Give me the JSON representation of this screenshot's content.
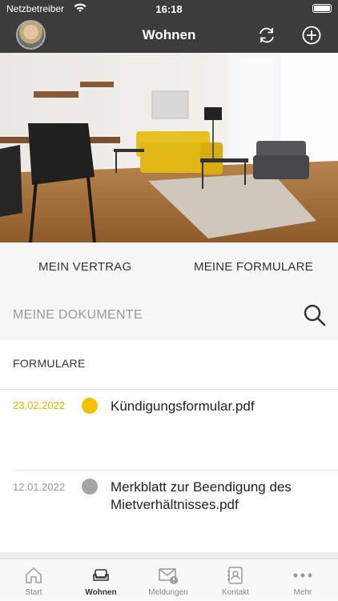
{
  "status_bar": {
    "carrier": "Netzbetreiber",
    "time": "16:18"
  },
  "header": {
    "title": "Wohnen",
    "refresh_icon": "refresh-icon",
    "add_icon": "plus-circle-icon"
  },
  "tabs": {
    "contract": "MEIN VERTRAG",
    "forms": "MEINE FORMULARE"
  },
  "search": {
    "label": "MEINE DOKUMENTE",
    "icon": "search-icon"
  },
  "section": {
    "title": "FORMULARE"
  },
  "documents": [
    {
      "date": "23.02.2022",
      "name": "Kündigungsformular.pdf",
      "status_color": "#f5c000",
      "date_color": "#e8b400"
    },
    {
      "date": "12.01.2022",
      "name": "Merkblatt zur Beendigung des Mietverhältnisses.pdf",
      "status_color": "#a5a5a5",
      "date_color": "#999999"
    }
  ],
  "tabbar": [
    {
      "label": "Start",
      "icon": "home-icon"
    },
    {
      "label": "Wohnen",
      "icon": "sofa-icon",
      "active": true
    },
    {
      "label": "Meldungen",
      "icon": "mail-alert-icon"
    },
    {
      "label": "Kontakt",
      "icon": "contacts-book-icon"
    },
    {
      "label": "Mehr",
      "icon": "more-dots-icon"
    }
  ],
  "colors": {
    "nav_bg": "#3c3c3c",
    "accent": "#f5c000"
  }
}
